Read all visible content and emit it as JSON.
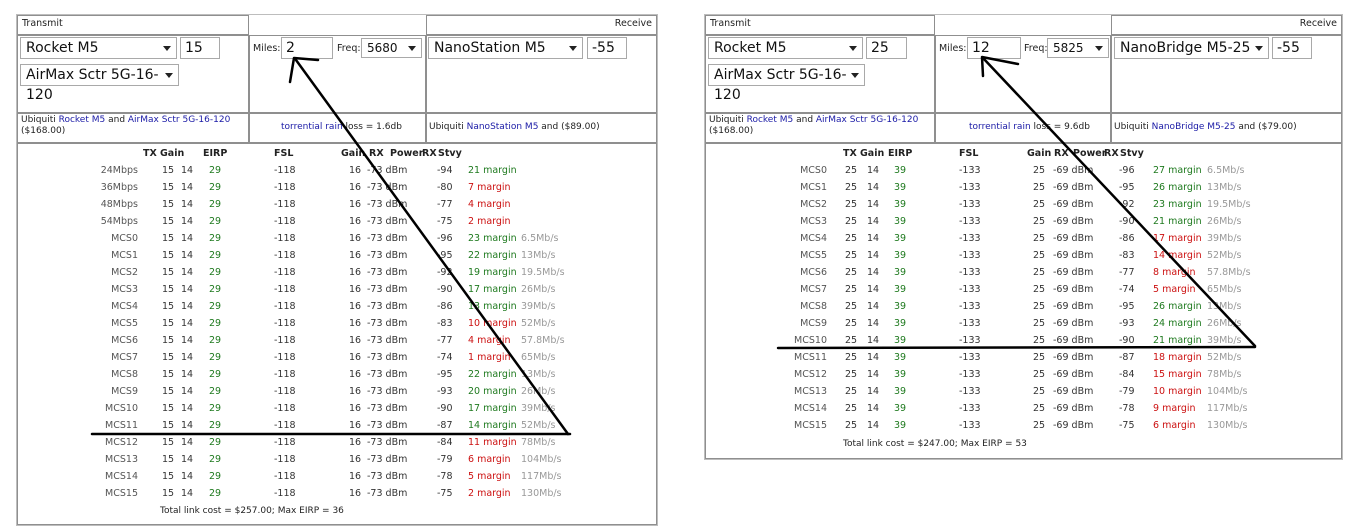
{
  "left": {
    "transmit_label": "Transmit",
    "receive_label": "Receive",
    "tx_radio": "Rocket M5",
    "tx_power": "15",
    "tx_antenna": "AirMax Sctr 5G-16-120",
    "miles_label": "Miles:",
    "miles": "2",
    "freq_label": "Freq:",
    "freq": "5680",
    "rx_radio": "NanoStation M5",
    "rx_signal": "-55",
    "tx_desc": {
      "pre": "Ubiquiti ",
      "radio": "Rocket M5",
      "and": " and ",
      "antenna": "AirMax Sctr 5G-16-120",
      "price": "($168.00)"
    },
    "loss": {
      "link": "torrential rain",
      "text": " loss = 1.6db"
    },
    "rx_desc": {
      "pre": "Ubiquiti ",
      "radio": "NanoStation M5",
      "post": " and ($89.00)"
    },
    "headers": [
      "TX",
      "Gain",
      "EIRP",
      "FSL",
      "Gain",
      "RX",
      "Power",
      "RX",
      "Stvy"
    ],
    "rows": [
      {
        "mode": "24Mbps",
        "tx": "15",
        "gain": "14",
        "eirp": "29",
        "fsl": "-118",
        "rgain": "16",
        "power": "-73 dBm",
        "sens": "-94",
        "margin": "21 margin",
        "ok": true,
        "rate": ""
      },
      {
        "mode": "36Mbps",
        "tx": "15",
        "gain": "14",
        "eirp": "29",
        "fsl": "-118",
        "rgain": "16",
        "power": "-73 dBm",
        "sens": "-80",
        "margin": "7 margin",
        "ok": false,
        "rate": ""
      },
      {
        "mode": "48Mbps",
        "tx": "15",
        "gain": "14",
        "eirp": "29",
        "fsl": "-118",
        "rgain": "16",
        "power": "-73 dBm",
        "sens": "-77",
        "margin": "4 margin",
        "ok": false,
        "rate": ""
      },
      {
        "mode": "54Mbps",
        "tx": "15",
        "gain": "14",
        "eirp": "29",
        "fsl": "-118",
        "rgain": "16",
        "power": "-73 dBm",
        "sens": "-75",
        "margin": "2 margin",
        "ok": false,
        "rate": ""
      },
      {
        "mode": "MCS0",
        "tx": "15",
        "gain": "14",
        "eirp": "29",
        "fsl": "-118",
        "rgain": "16",
        "power": "-73 dBm",
        "sens": "-96",
        "margin": "23 margin",
        "ok": true,
        "rate": "6.5Mb/s"
      },
      {
        "mode": "MCS1",
        "tx": "15",
        "gain": "14",
        "eirp": "29",
        "fsl": "-118",
        "rgain": "16",
        "power": "-73 dBm",
        "sens": "-95",
        "margin": "22 margin",
        "ok": true,
        "rate": "13Mb/s"
      },
      {
        "mode": "MCS2",
        "tx": "15",
        "gain": "14",
        "eirp": "29",
        "fsl": "-118",
        "rgain": "16",
        "power": "-73 dBm",
        "sens": "-92",
        "margin": "19 margin",
        "ok": true,
        "rate": "19.5Mb/s"
      },
      {
        "mode": "MCS3",
        "tx": "15",
        "gain": "14",
        "eirp": "29",
        "fsl": "-118",
        "rgain": "16",
        "power": "-73 dBm",
        "sens": "-90",
        "margin": "17 margin",
        "ok": true,
        "rate": "26Mb/s"
      },
      {
        "mode": "MCS4",
        "tx": "15",
        "gain": "14",
        "eirp": "29",
        "fsl": "-118",
        "rgain": "16",
        "power": "-73 dBm",
        "sens": "-86",
        "margin": "13 margin",
        "ok": true,
        "rate": "39Mb/s"
      },
      {
        "mode": "MCS5",
        "tx": "15",
        "gain": "14",
        "eirp": "29",
        "fsl": "-118",
        "rgain": "16",
        "power": "-73 dBm",
        "sens": "-83",
        "margin": "10 margin",
        "ok": false,
        "rate": "52Mb/s"
      },
      {
        "mode": "MCS6",
        "tx": "15",
        "gain": "14",
        "eirp": "29",
        "fsl": "-118",
        "rgain": "16",
        "power": "-73 dBm",
        "sens": "-77",
        "margin": "4 margin",
        "ok": false,
        "rate": "57.8Mb/s"
      },
      {
        "mode": "MCS7",
        "tx": "15",
        "gain": "14",
        "eirp": "29",
        "fsl": "-118",
        "rgain": "16",
        "power": "-73 dBm",
        "sens": "-74",
        "margin": "1 margin",
        "ok": false,
        "rate": "65Mb/s"
      },
      {
        "mode": "MCS8",
        "tx": "15",
        "gain": "14",
        "eirp": "29",
        "fsl": "-118",
        "rgain": "16",
        "power": "-73 dBm",
        "sens": "-95",
        "margin": "22 margin",
        "ok": true,
        "rate": "13Mb/s"
      },
      {
        "mode": "MCS9",
        "tx": "15",
        "gain": "14",
        "eirp": "29",
        "fsl": "-118",
        "rgain": "16",
        "power": "-73 dBm",
        "sens": "-93",
        "margin": "20 margin",
        "ok": true,
        "rate": "26Mb/s"
      },
      {
        "mode": "MCS10",
        "tx": "15",
        "gain": "14",
        "eirp": "29",
        "fsl": "-118",
        "rgain": "16",
        "power": "-73 dBm",
        "sens": "-90",
        "margin": "17 margin",
        "ok": true,
        "rate": "39Mb/s"
      },
      {
        "mode": "MCS11",
        "tx": "15",
        "gain": "14",
        "eirp": "29",
        "fsl": "-118",
        "rgain": "16",
        "power": "-73 dBm",
        "sens": "-87",
        "margin": "14 margin",
        "ok": true,
        "rate": "52Mb/s"
      },
      {
        "mode": "MCS12",
        "tx": "15",
        "gain": "14",
        "eirp": "29",
        "fsl": "-118",
        "rgain": "16",
        "power": "-73 dBm",
        "sens": "-84",
        "margin": "11 margin",
        "ok": false,
        "rate": "78Mb/s"
      },
      {
        "mode": "MCS13",
        "tx": "15",
        "gain": "14",
        "eirp": "29",
        "fsl": "-118",
        "rgain": "16",
        "power": "-73 dBm",
        "sens": "-79",
        "margin": "6 margin",
        "ok": false,
        "rate": "104Mb/s"
      },
      {
        "mode": "MCS14",
        "tx": "15",
        "gain": "14",
        "eirp": "29",
        "fsl": "-118",
        "rgain": "16",
        "power": "-73 dBm",
        "sens": "-78",
        "margin": "5 margin",
        "ok": false,
        "rate": "117Mb/s"
      },
      {
        "mode": "MCS15",
        "tx": "15",
        "gain": "14",
        "eirp": "29",
        "fsl": "-118",
        "rgain": "16",
        "power": "-73 dBm",
        "sens": "-75",
        "margin": "2 margin",
        "ok": false,
        "rate": "130Mb/s"
      }
    ],
    "footer": "Total link cost = $257.00; Max EIRP = 36"
  },
  "right": {
    "transmit_label": "Transmit",
    "receive_label": "Receive",
    "tx_radio": "Rocket M5",
    "tx_power": "25",
    "tx_antenna": "AirMax Sctr 5G-16-120",
    "miles_label": "Miles:",
    "miles": "12",
    "freq_label": "Freq:",
    "freq": "5825",
    "rx_radio": "NanoBridge M5-25",
    "rx_signal": "-55",
    "tx_desc": {
      "pre": "Ubiquiti ",
      "radio": "Rocket M5",
      "and": " and ",
      "antenna": "AirMax Sctr 5G-16-120",
      "price": "($168.00)"
    },
    "loss": {
      "link": "torrential rain",
      "text": " loss = 9.6db"
    },
    "rx_desc": {
      "pre": "Ubiquiti ",
      "radio": "NanoBridge M5-25",
      "post": " and ($79.00)"
    },
    "headers": [
      "TX",
      "Gain",
      "EIRP",
      "FSL",
      "Gain",
      "RX",
      "Power",
      "RX",
      "Stvy"
    ],
    "rows": [
      {
        "mode": "MCS0",
        "tx": "25",
        "gain": "14",
        "eirp": "39",
        "fsl": "-133",
        "rgain": "25",
        "power": "-69 dBm",
        "sens": "-96",
        "margin": "27 margin",
        "ok": true,
        "rate": "6.5Mb/s"
      },
      {
        "mode": "MCS1",
        "tx": "25",
        "gain": "14",
        "eirp": "39",
        "fsl": "-133",
        "rgain": "25",
        "power": "-69 dBm",
        "sens": "-95",
        "margin": "26 margin",
        "ok": true,
        "rate": "13Mb/s"
      },
      {
        "mode": "MCS2",
        "tx": "25",
        "gain": "14",
        "eirp": "39",
        "fsl": "-133",
        "rgain": "25",
        "power": "-69 dBm",
        "sens": "-92",
        "margin": "23 margin",
        "ok": true,
        "rate": "19.5Mb/s"
      },
      {
        "mode": "MCS3",
        "tx": "25",
        "gain": "14",
        "eirp": "39",
        "fsl": "-133",
        "rgain": "25",
        "power": "-69 dBm",
        "sens": "-90",
        "margin": "21 margin",
        "ok": true,
        "rate": "26Mb/s"
      },
      {
        "mode": "MCS4",
        "tx": "25",
        "gain": "14",
        "eirp": "39",
        "fsl": "-133",
        "rgain": "25",
        "power": "-69 dBm",
        "sens": "-86",
        "margin": "17 margin",
        "ok": false,
        "rate": "39Mb/s"
      },
      {
        "mode": "MCS5",
        "tx": "25",
        "gain": "14",
        "eirp": "39",
        "fsl": "-133",
        "rgain": "25",
        "power": "-69 dBm",
        "sens": "-83",
        "margin": "14 margin",
        "ok": false,
        "rate": "52Mb/s"
      },
      {
        "mode": "MCS6",
        "tx": "25",
        "gain": "14",
        "eirp": "39",
        "fsl": "-133",
        "rgain": "25",
        "power": "-69 dBm",
        "sens": "-77",
        "margin": "8 margin",
        "ok": false,
        "rate": "57.8Mb/s"
      },
      {
        "mode": "MCS7",
        "tx": "25",
        "gain": "14",
        "eirp": "39",
        "fsl": "-133",
        "rgain": "25",
        "power": "-69 dBm",
        "sens": "-74",
        "margin": "5 margin",
        "ok": false,
        "rate": "65Mb/s"
      },
      {
        "mode": "MCS8",
        "tx": "25",
        "gain": "14",
        "eirp": "39",
        "fsl": "-133",
        "rgain": "25",
        "power": "-69 dBm",
        "sens": "-95",
        "margin": "26 margin",
        "ok": true,
        "rate": "13Mb/s"
      },
      {
        "mode": "MCS9",
        "tx": "25",
        "gain": "14",
        "eirp": "39",
        "fsl": "-133",
        "rgain": "25",
        "power": "-69 dBm",
        "sens": "-93",
        "margin": "24 margin",
        "ok": true,
        "rate": "26Mb/s"
      },
      {
        "mode": "MCS10",
        "tx": "25",
        "gain": "14",
        "eirp": "39",
        "fsl": "-133",
        "rgain": "25",
        "power": "-69 dBm",
        "sens": "-90",
        "margin": "21 margin",
        "ok": true,
        "rate": "39Mb/s"
      },
      {
        "mode": "MCS11",
        "tx": "25",
        "gain": "14",
        "eirp": "39",
        "fsl": "-133",
        "rgain": "25",
        "power": "-69 dBm",
        "sens": "-87",
        "margin": "18 margin",
        "ok": false,
        "rate": "52Mb/s"
      },
      {
        "mode": "MCS12",
        "tx": "25",
        "gain": "14",
        "eirp": "39",
        "fsl": "-133",
        "rgain": "25",
        "power": "-69 dBm",
        "sens": "-84",
        "margin": "15 margin",
        "ok": false,
        "rate": "78Mb/s"
      },
      {
        "mode": "MCS13",
        "tx": "25",
        "gain": "14",
        "eirp": "39",
        "fsl": "-133",
        "rgain": "25",
        "power": "-69 dBm",
        "sens": "-79",
        "margin": "10 margin",
        "ok": false,
        "rate": "104Mb/s"
      },
      {
        "mode": "MCS14",
        "tx": "25",
        "gain": "14",
        "eirp": "39",
        "fsl": "-133",
        "rgain": "25",
        "power": "-69 dBm",
        "sens": "-78",
        "margin": "9 margin",
        "ok": false,
        "rate": "117Mb/s"
      },
      {
        "mode": "MCS15",
        "tx": "25",
        "gain": "14",
        "eirp": "39",
        "fsl": "-133",
        "rgain": "25",
        "power": "-69 dBm",
        "sens": "-75",
        "margin": "6 margin",
        "ok": false,
        "rate": "130Mb/s"
      }
    ],
    "footer": "Total link cost = $247.00; Max EIRP = 53"
  },
  "colors": {
    "margin_ok": "#1f7a1f",
    "margin_bad": "#cc1111",
    "link": "#1a1aa6",
    "annotation": "#000000"
  }
}
